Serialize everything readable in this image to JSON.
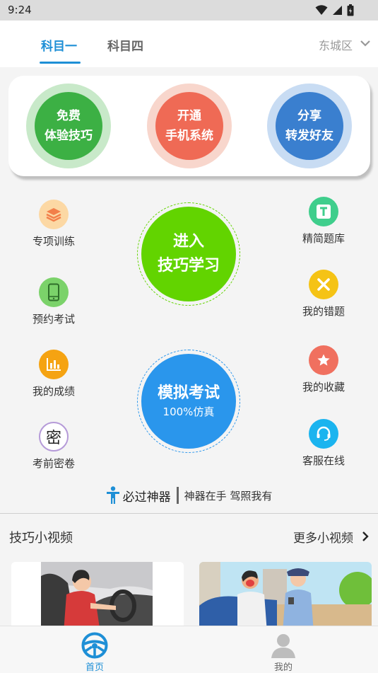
{
  "status": {
    "time": "9:24"
  },
  "tabs": [
    {
      "label": "科目一"
    },
    {
      "label": "科目四"
    }
  ],
  "district": "东城区",
  "promo": [
    {
      "line1": "免费",
      "line2": "体验技巧"
    },
    {
      "line1": "开通",
      "line2": "手机系统"
    },
    {
      "line1": "分享",
      "line2": "转发好友"
    }
  ],
  "features": {
    "special_training": "专项训练",
    "book_exam": "预约考试",
    "my_scores": "我的成绩",
    "pre_exam": "考前密卷",
    "simplified_bank": "精简题库",
    "my_mistakes": "我的错题",
    "my_favorites": "我的收藏",
    "customer_service": "客服在线",
    "secret_glyph": "密"
  },
  "enter_learning": {
    "line1": "进入",
    "line2": "技巧学习"
  },
  "mock_exam": {
    "title": "模拟考试",
    "subtitle": "100%仿真"
  },
  "slogan": {
    "main": "必过神器",
    "sub": "神器在手  驾照我有"
  },
  "videos": {
    "title": "技巧小视频",
    "more": "更多小视频"
  },
  "bottom_nav": [
    {
      "label": "首页"
    },
    {
      "label": "我的"
    }
  ],
  "colors": {
    "accent": "#1e8fd6",
    "green": "#3cb044",
    "red": "#ef6a55",
    "blue": "#3a7fcf",
    "enter_green": "#62d400",
    "mock_blue": "#2a96ec"
  }
}
